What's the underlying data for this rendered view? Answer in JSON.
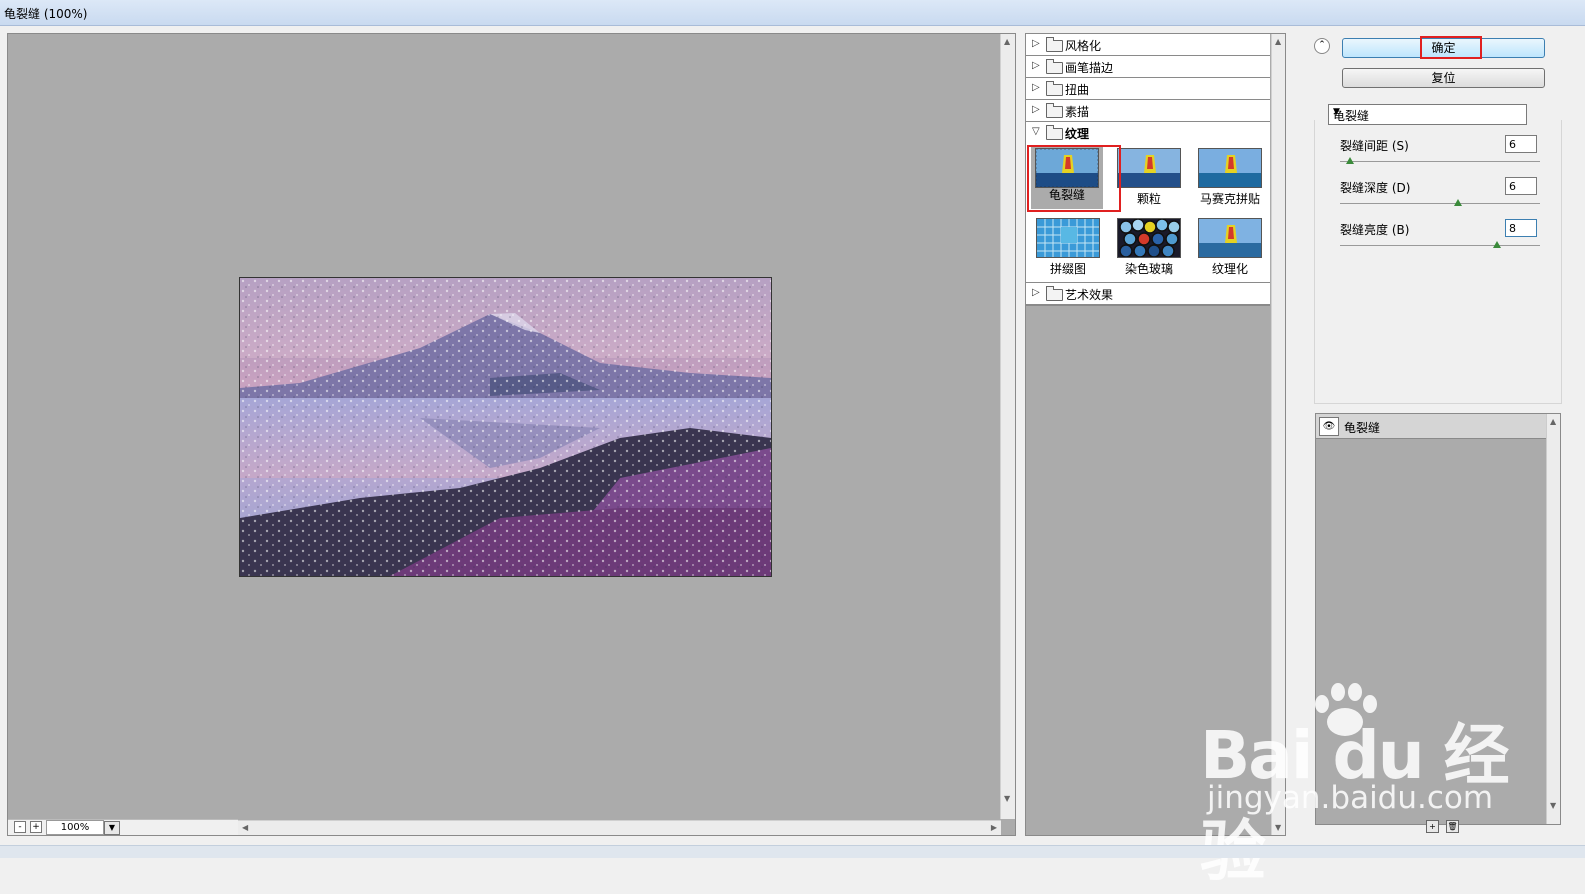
{
  "window": {
    "title": "龟裂缝 (100%)"
  },
  "preview": {
    "zoom": "100%",
    "zoom_out": "-",
    "zoom_in": "+"
  },
  "filter_gallery": {
    "categories": [
      {
        "label": "风格化",
        "expanded": false
      },
      {
        "label": "画笔描边",
        "expanded": false
      },
      {
        "label": "扭曲",
        "expanded": false
      },
      {
        "label": "素描",
        "expanded": false
      },
      {
        "label": "纹理",
        "expanded": true
      },
      {
        "label": "艺术效果",
        "expanded": false
      }
    ],
    "texture_filters": [
      {
        "label": "龟裂缝",
        "selected": true
      },
      {
        "label": "颗粒",
        "selected": false
      },
      {
        "label": "马赛克拼贴",
        "selected": false
      },
      {
        "label": "拼缀图",
        "selected": false
      },
      {
        "label": "染色玻璃",
        "selected": false
      },
      {
        "label": "纹理化",
        "selected": false
      }
    ]
  },
  "actions": {
    "ok_label": "确定",
    "reset_label": "复位"
  },
  "filter_select": {
    "value": "龟裂缝"
  },
  "params": [
    {
      "label": "裂缝间距 (S)",
      "value": "6",
      "level": 0.05
    },
    {
      "label": "裂缝深度 (D)",
      "value": "6",
      "level": 0.6
    },
    {
      "label": "裂缝亮度 (B)",
      "value": "8",
      "level": 0.8
    }
  ],
  "layers": {
    "items": [
      {
        "label": "龟裂缝"
      }
    ]
  },
  "watermark": {
    "main": "Bai du 经验",
    "sub": "jingyan.baidu.com"
  },
  "colors": {
    "highlight_red": "#e02020",
    "canvas_gray": "#ababab"
  }
}
